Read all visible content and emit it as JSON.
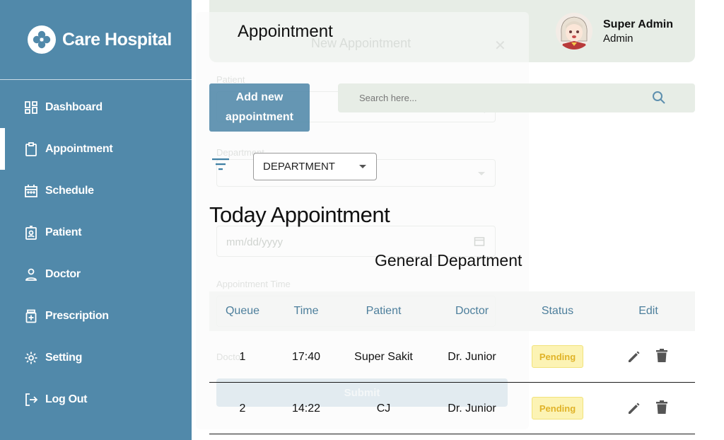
{
  "sidebar": {
    "brand": "Care Hospital",
    "items": [
      {
        "label": "Dashboard",
        "icon": "dashboard-icon"
      },
      {
        "label": "Appointment",
        "icon": "clipboard-icon",
        "active": true
      },
      {
        "label": "Schedule",
        "icon": "calendar-icon"
      },
      {
        "label": "Patient",
        "icon": "patient-badge-icon"
      },
      {
        "label": "Doctor",
        "icon": "person-icon"
      },
      {
        "label": "Prescription",
        "icon": "prescription-icon"
      },
      {
        "label": "Setting",
        "icon": "gear-icon"
      },
      {
        "label": "Log Out",
        "icon": "logout-icon"
      }
    ]
  },
  "header": {
    "title": "Appointment",
    "user_name": "Super Admin",
    "user_role": "Admin"
  },
  "modal": {
    "title": "New Appointment",
    "patient_label": "Patient",
    "department_label": "Department",
    "date_placeholder": "mm/dd/yyyy",
    "time_label": "Appointment Time",
    "doctor_label": "Doctor",
    "submit_label": "Submit"
  },
  "toolbar": {
    "add_label_line1": "Add new",
    "add_label_line2": "appointment",
    "search_placeholder": "Search here...",
    "department_select": "DEPARTMENT"
  },
  "main": {
    "section_title": "Today Appointment",
    "department_title": "General Department"
  },
  "table": {
    "headers": [
      "Queue",
      "Time",
      "Patient",
      "Doctor",
      "Status",
      "Edit"
    ],
    "rows": [
      {
        "queue": "1",
        "time": "17:40",
        "patient": "Super Sakit",
        "doctor": "Dr. Junior",
        "status": "Pending"
      },
      {
        "queue": "2",
        "time": "14:22",
        "patient": "CJ",
        "doctor": "Dr. Junior",
        "status": "Pending"
      }
    ]
  },
  "colors": {
    "sidebar": "#5189aa",
    "header_bg": "#e7ede6",
    "header_text": "#4d7f9c",
    "pending_bg": "#fcf3b4",
    "pending_text": "#e0b328"
  }
}
